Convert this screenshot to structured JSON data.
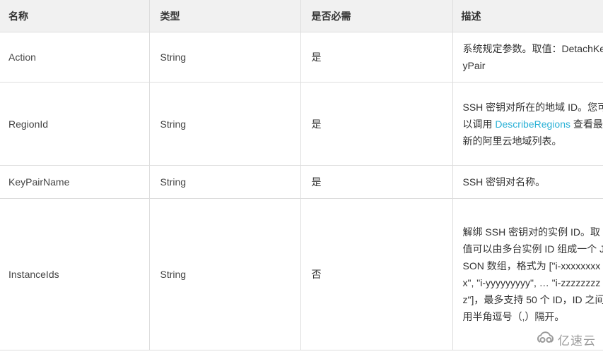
{
  "table": {
    "headers": [
      "名称",
      "类型",
      "是否必需",
      "描述"
    ],
    "rows": [
      {
        "name": "Action",
        "type": "String",
        "required": "是",
        "description": "系统规定参数。取值：DetachKeyPair",
        "link_text": "",
        "description_suffix": ""
      },
      {
        "name": "RegionId",
        "type": "String",
        "required": "是",
        "description": "SSH 密钥对所在的地域 ID。您可以调用 ",
        "link_text": "DescribeRegions",
        "description_suffix": " 查看最新的阿里云地域列表。"
      },
      {
        "name": "KeyPairName",
        "type": "String",
        "required": "是",
        "description": "SSH 密钥对名称。",
        "link_text": "",
        "description_suffix": ""
      },
      {
        "name": "InstanceIds",
        "type": "String",
        "required": "否",
        "description": "解绑 SSH 密钥对的实例 ID。取值可以由多台实例 ID 组成一个 JSON 数组，格式为 [\"i-xxxxxxxxx\", \"i-yyyyyyyyy\", … \"i-zzzzzzzzz\"]，最多支持 50 个 ID，ID 之间用半角逗号（,）隔开。",
        "link_text": "",
        "description_suffix": ""
      }
    ]
  },
  "watermark": {
    "text": "亿速云",
    "icon": "cloud-logo-icon"
  },
  "colors": {
    "header_bg": "#f1f1f1",
    "border": "#dddddd",
    "link": "#2bb1d6",
    "text": "#333333"
  }
}
